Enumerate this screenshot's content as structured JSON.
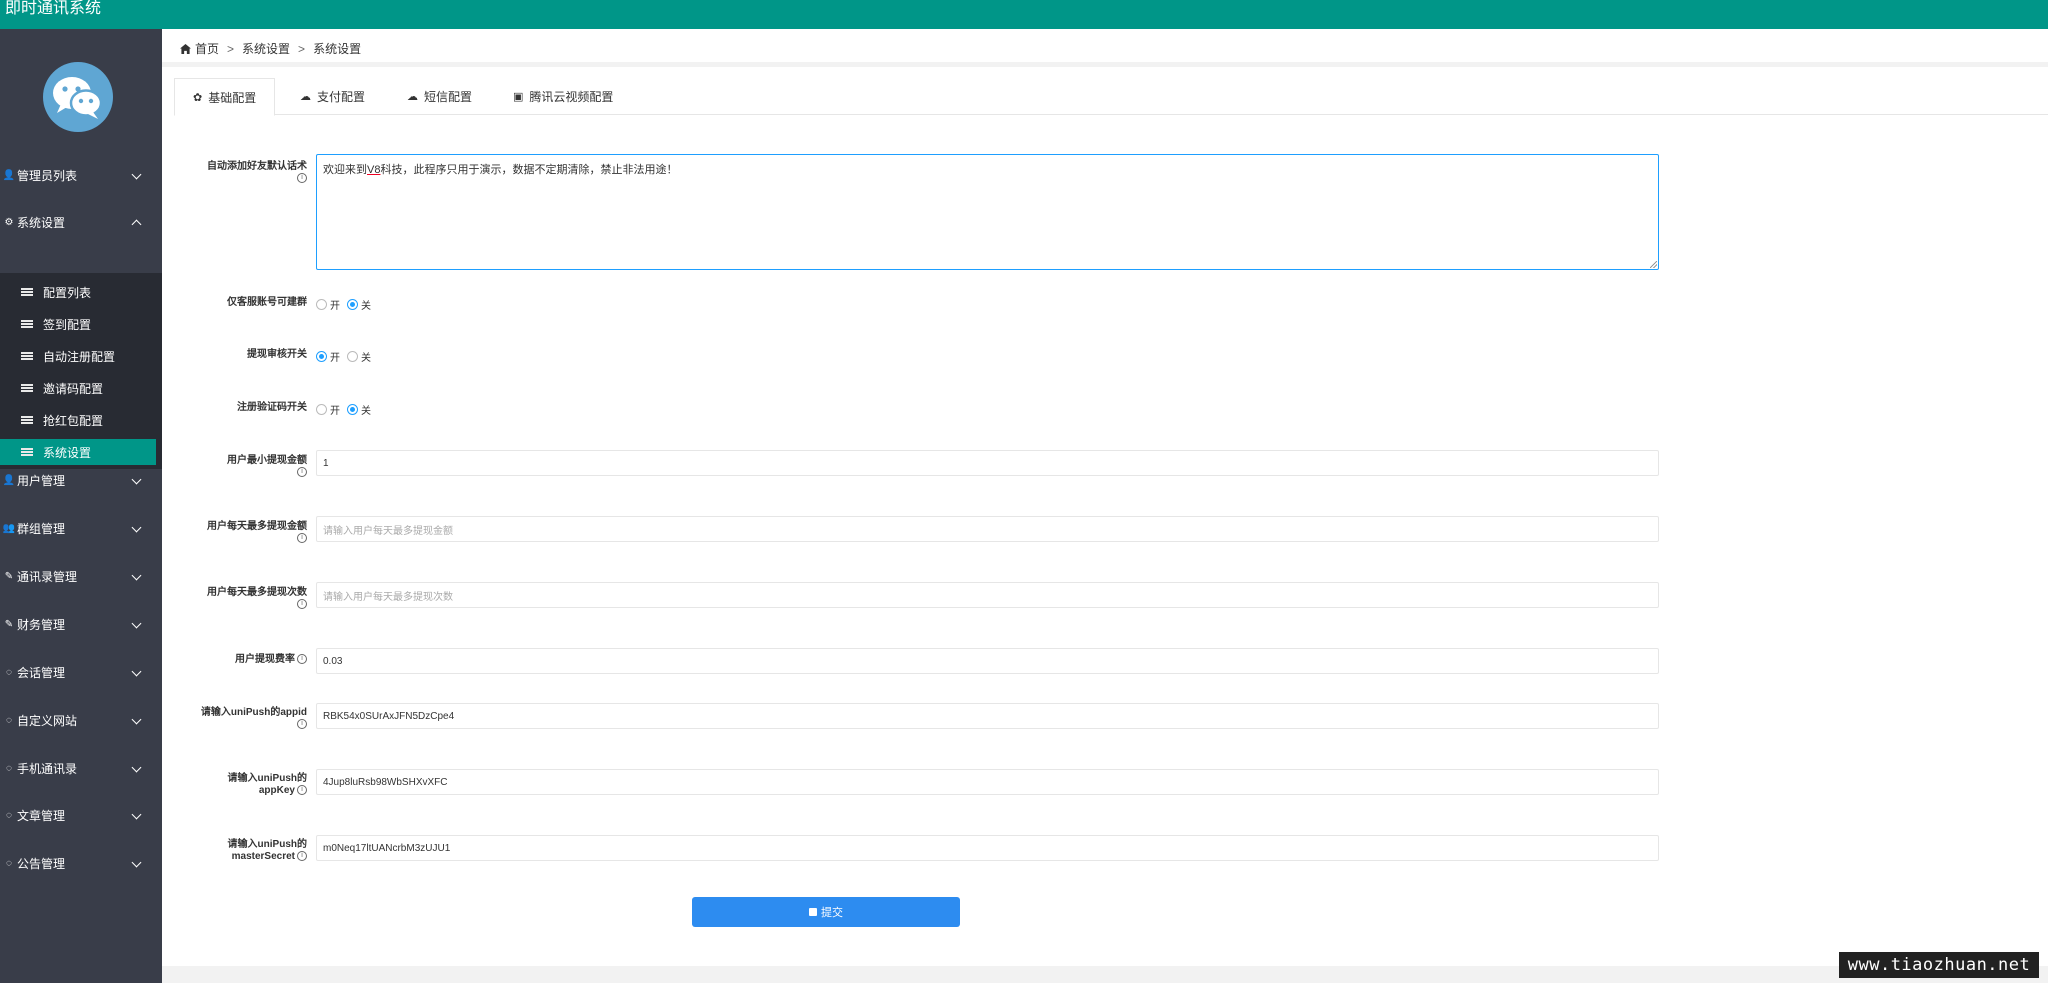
{
  "app": {
    "title": "即时通讯系统"
  },
  "sidebar": {
    "items": [
      {
        "label": "管理员列表",
        "icon": "user-icon",
        "glyph": "👤"
      },
      {
        "label": "系统设置",
        "icon": "gear-icon",
        "glyph": "⚙"
      },
      {
        "label": "用户管理",
        "icon": "user-icon",
        "glyph": "👤"
      },
      {
        "label": "群组管理",
        "icon": "users-icon",
        "glyph": "👥"
      },
      {
        "label": "通讯录管理",
        "icon": "edit-icon",
        "glyph": "✎"
      },
      {
        "label": "财务管理",
        "icon": "edit-icon",
        "glyph": "✎"
      },
      {
        "label": "会话管理",
        "icon": "chat-icon",
        "glyph": "◌"
      },
      {
        "label": "自定义网站",
        "icon": "chat-icon",
        "glyph": "◌"
      },
      {
        "label": "手机通讯录",
        "icon": "chat-icon",
        "glyph": "◌"
      },
      {
        "label": "文章管理",
        "icon": "chat-icon",
        "glyph": "◌"
      },
      {
        "label": "公告管理",
        "icon": "chat-icon",
        "glyph": "◌"
      }
    ],
    "submenu": [
      {
        "label": "配置列表"
      },
      {
        "label": "签到配置"
      },
      {
        "label": "自动注册配置"
      },
      {
        "label": "邀请码配置"
      },
      {
        "label": "抢红包配置"
      },
      {
        "label": "系统设置"
      }
    ]
  },
  "breadcrumb": {
    "home": "首页",
    "level1": "系统设置",
    "level2": "系统设置",
    "sep": ">"
  },
  "tabs": [
    {
      "label": "基础配置",
      "icon": "gear-icon",
      "glyph": "✿"
    },
    {
      "label": "支付配置",
      "icon": "cloud-icon",
      "glyph": "☁"
    },
    {
      "label": "短信配置",
      "icon": "cloud-icon",
      "glyph": "☁"
    },
    {
      "label": "腾讯云视频配置",
      "icon": "cube-icon",
      "glyph": "▣"
    }
  ],
  "form": {
    "greeting": {
      "label": "自动添加好友默认话术",
      "value_prefix": "欢迎来到",
      "value_underlined": "V8",
      "value_suffix": "科技，此程序只用于演示，数据不定期清除，禁止非法用途！"
    },
    "cs_group": {
      "label": "仅客服账号可建群",
      "on": "开",
      "off": "关",
      "selected": "关"
    },
    "withdraw_review": {
      "label": "提现审核开关",
      "on": "开",
      "off": "关",
      "selected": "开"
    },
    "register_captcha": {
      "label": "注册验证码开关",
      "on": "开",
      "off": "关",
      "selected": "关"
    },
    "min_withdraw": {
      "label": "用户最小提现金额",
      "value": "1"
    },
    "max_daily_amount": {
      "label": "用户每天最多提现金额",
      "placeholder": "请输入用户每天最多提现金额"
    },
    "max_daily_times": {
      "label": "用户每天最多提现次数",
      "placeholder": "请输入用户每天最多提现次数"
    },
    "fee_rate": {
      "label": "用户提现费率",
      "value": "0.03"
    },
    "unipush_appid": {
      "label": "请输入uniPush的appid",
      "value": "RBK54x0SUrAxJFN5DzCpe4"
    },
    "unipush_appkey": {
      "label": "请输入uniPush的appKey",
      "value": "4Jup8luRsb98WbSHXvXFC"
    },
    "unipush_secret": {
      "label": "请输入uniPush的masterSecret",
      "value": "m0Neq17ltUANcrbM3zUJU1"
    },
    "submit": "提交"
  },
  "watermark": "www.tiaozhuan.net",
  "colors": {
    "topbar": "#009688",
    "sidebar": "#393d49",
    "active": "#009688",
    "primary": "#2d8cf0"
  }
}
